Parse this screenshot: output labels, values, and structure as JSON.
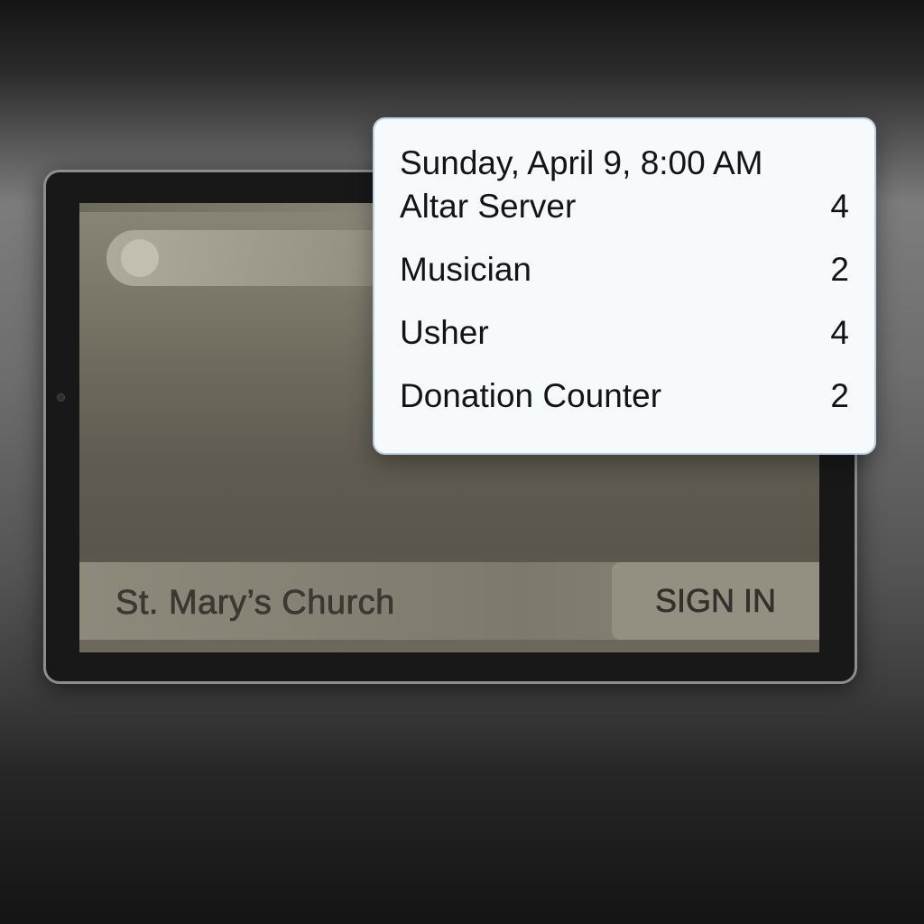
{
  "site": {
    "brand": "St. Mary’s Church",
    "sign_in_label": "SIGN IN"
  },
  "popover": {
    "title": "Sunday, April 9, 8:00 AM",
    "roles": [
      {
        "name": "Altar Server",
        "count": "4"
      },
      {
        "name": "Musician",
        "count": "2"
      },
      {
        "name": "Usher",
        "count": "4"
      },
      {
        "name": "Donation Counter",
        "count": "2"
      }
    ]
  }
}
